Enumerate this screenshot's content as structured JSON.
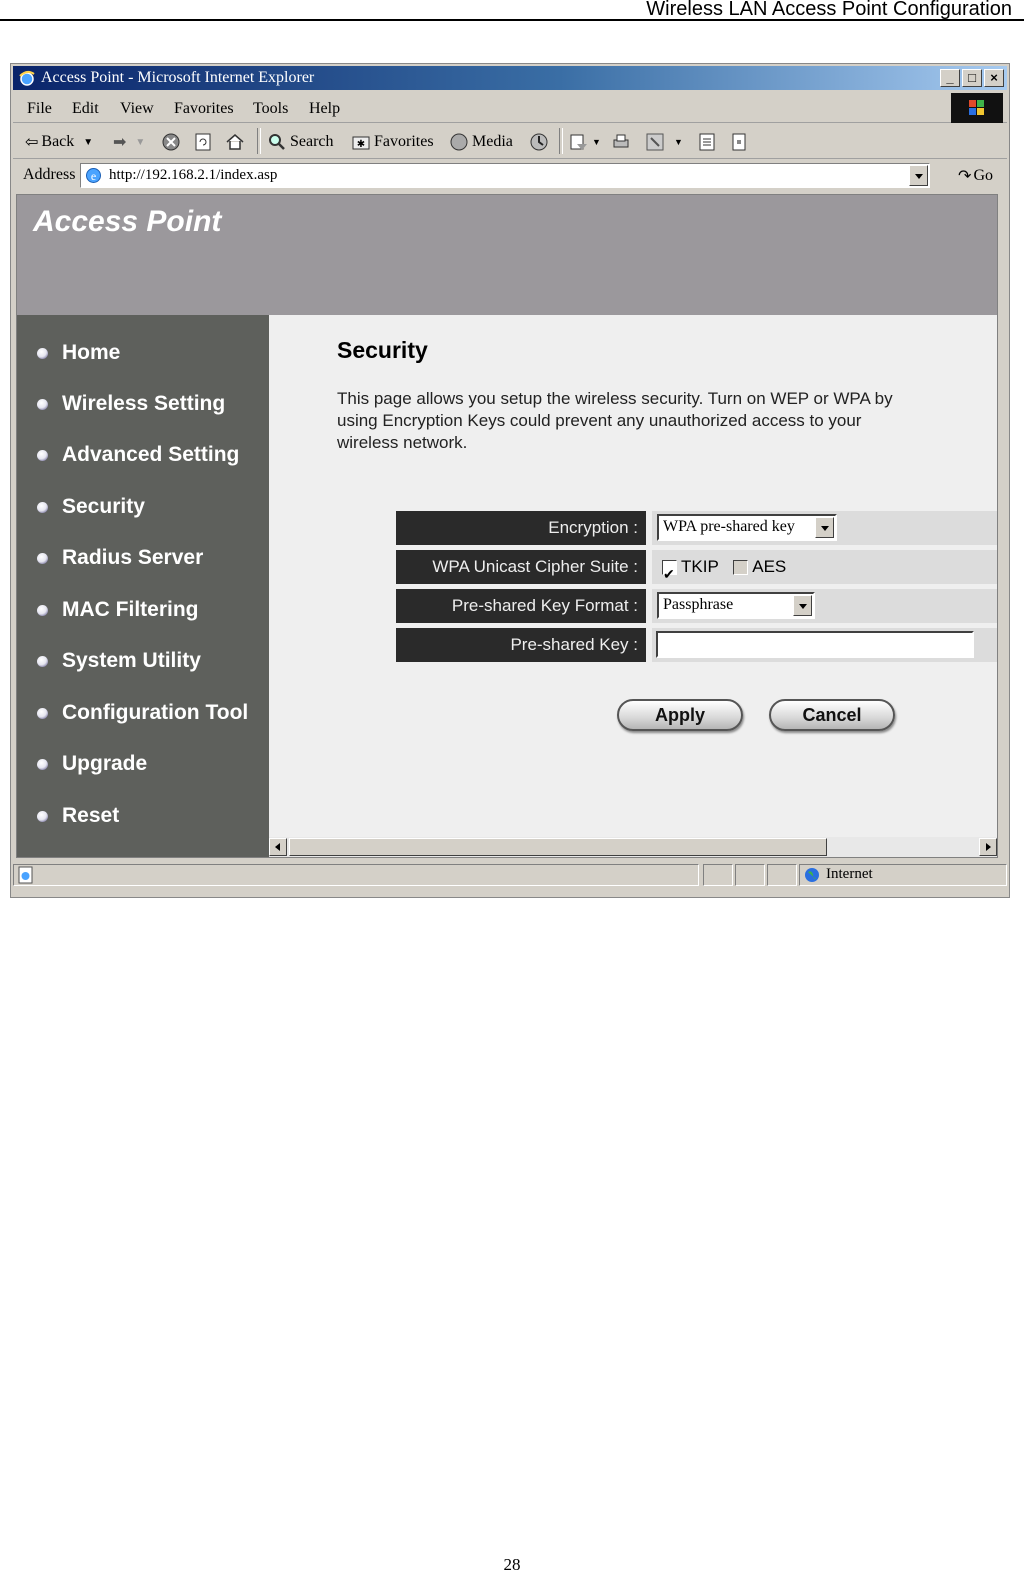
{
  "document": {
    "header_title": "Wireless LAN Access Point Configuration",
    "page_number": "28"
  },
  "browser": {
    "window_title": "Access Point - Microsoft Internet Explorer",
    "window_buttons": {
      "minimize": "_",
      "maximize": "□",
      "close": "×"
    },
    "menu": [
      "File",
      "Edit",
      "View",
      "Favorites",
      "Tools",
      "Help"
    ],
    "toolbar": {
      "back": "Back",
      "search": "Search",
      "favorites": "Favorites",
      "media": "Media"
    },
    "address_label": "Address",
    "address_value": "http://192.168.2.1/index.asp",
    "go_label": "Go",
    "status_zone": "Internet"
  },
  "app": {
    "brand": "Access Point",
    "nav": [
      {
        "label": "Home"
      },
      {
        "label": "Wireless Setting"
      },
      {
        "label": "Advanced Setting"
      },
      {
        "label": "Security"
      },
      {
        "label": "Radius Server"
      },
      {
        "label": "MAC Filtering"
      },
      {
        "label": "System Utility"
      },
      {
        "label": "Configuration Tool"
      },
      {
        "label": "Upgrade"
      },
      {
        "label": "Reset"
      }
    ],
    "page_title": "Security",
    "description": "This page allows you setup the wireless security. Turn on WEP or WPA by using Encryption Keys could prevent any unauthorized access to your wireless network.",
    "form": {
      "encryption": {
        "label": "Encryption :",
        "value": "WPA pre-shared key"
      },
      "cipher_suite": {
        "label": "WPA Unicast Cipher Suite :",
        "options": [
          {
            "label": "TKIP",
            "checked": true
          },
          {
            "label": "AES",
            "checked": false
          }
        ]
      },
      "key_format": {
        "label": "Pre-shared Key Format :",
        "value": "Passphrase"
      },
      "preshared_key": {
        "label": "Pre-shared Key :",
        "value": ""
      }
    },
    "buttons": {
      "apply": "Apply",
      "cancel": "Cancel"
    }
  }
}
